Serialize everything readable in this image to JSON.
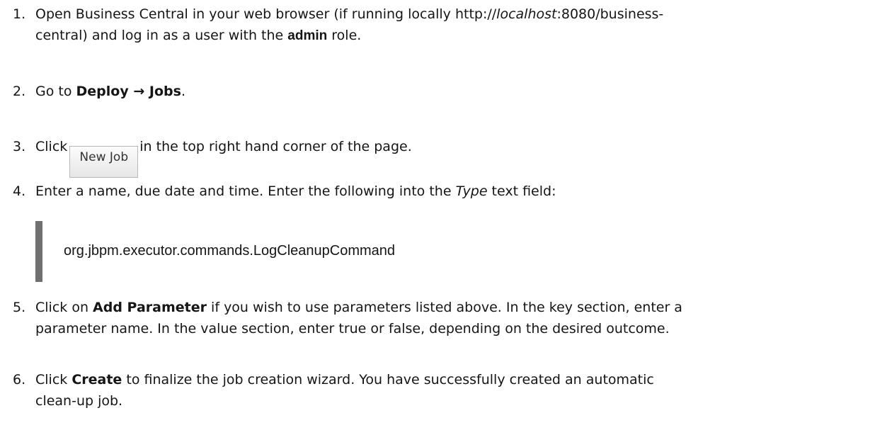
{
  "steps": [
    {
      "number": "1.",
      "line1_a": "Open Business Central in your web browser (if running locally http://",
      "line1_italic": "localhost",
      "line1_b": ":8080/business-",
      "line2_a": "central) and log in as a user with the ",
      "line2_bold": "admin",
      "line2_b": " role."
    },
    {
      "number": "2.",
      "a": "Go to ",
      "bold1": "Deploy",
      "arrow": " → ",
      "bold2": "Jobs",
      "b": "."
    },
    {
      "number": "3.",
      "a": "Click",
      "button_label": "New Job",
      "b": "in the top right hand corner of the page."
    },
    {
      "number": "4.",
      "a": "Enter a name, due date and time. Enter the following into the ",
      "italic": "Type",
      "b": " text field:",
      "code": "org.jbpm.executor.commands.LogCleanupCommand"
    },
    {
      "number": "5.",
      "a": "Click on ",
      "bold": "Add Parameter",
      "b": " if you wish to use parameters listed above. In the key section, enter a",
      "line2": "parameter name. In the value section, enter true or false, depending on the desired outcome."
    },
    {
      "number": "6.",
      "a": "Click ",
      "bold": "Create",
      "b": " to finalize the job creation wizard. You have successfully created an automatic",
      "line2": "clean-up job."
    }
  ]
}
